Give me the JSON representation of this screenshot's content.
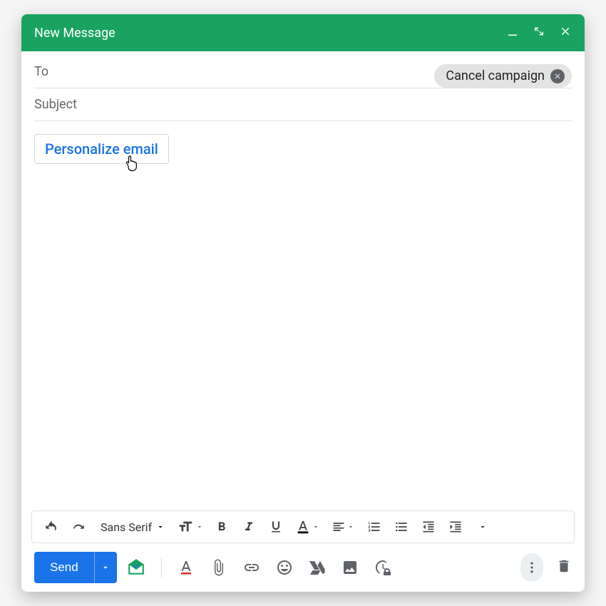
{
  "titlebar": {
    "title": "New Message"
  },
  "fields": {
    "to_label": "To",
    "subject_label": "Subject",
    "chip_label": "Cancel campaign"
  },
  "body": {
    "personalize_label": "Personalize email"
  },
  "format_toolbar": {
    "font_name": "Sans Serif"
  },
  "bottom": {
    "send_label": "Send"
  },
  "colors": {
    "header": "#1aa260",
    "primary_button": "#1a73e8",
    "link": "#1a73e8"
  }
}
